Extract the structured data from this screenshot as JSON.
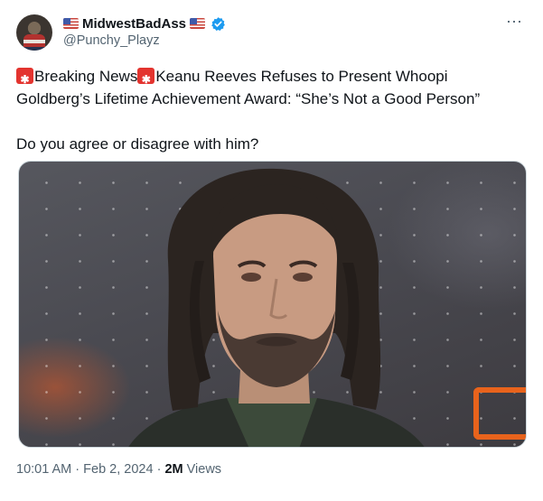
{
  "tweet": {
    "display_name": "MidwestBadAss",
    "handle": "@Punchy_Playz",
    "verified": true,
    "more_icon": "⋯",
    "text_part1": "Breaking News",
    "text_part2": "Keanu Reeves Refuses to Present Whoopi Goldberg’s Lifetime Achievement Award: “She’s Not a Good Person”",
    "text_question": "Do you agree or disagree with him?",
    "time": "10:01 AM",
    "sep1": " · ",
    "date": "Feb 2, 2024",
    "sep2": " · ",
    "views_count": "2M",
    "views_label": " Views"
  },
  "icons": {
    "flag": "us-flag-icon",
    "siren": "police-siren-icon",
    "verified": "verified-badge-icon",
    "more": "more-options-icon"
  },
  "colors": {
    "accent": "#1d9bf0",
    "secondary_text": "#536471",
    "siren": "#e3342f"
  }
}
